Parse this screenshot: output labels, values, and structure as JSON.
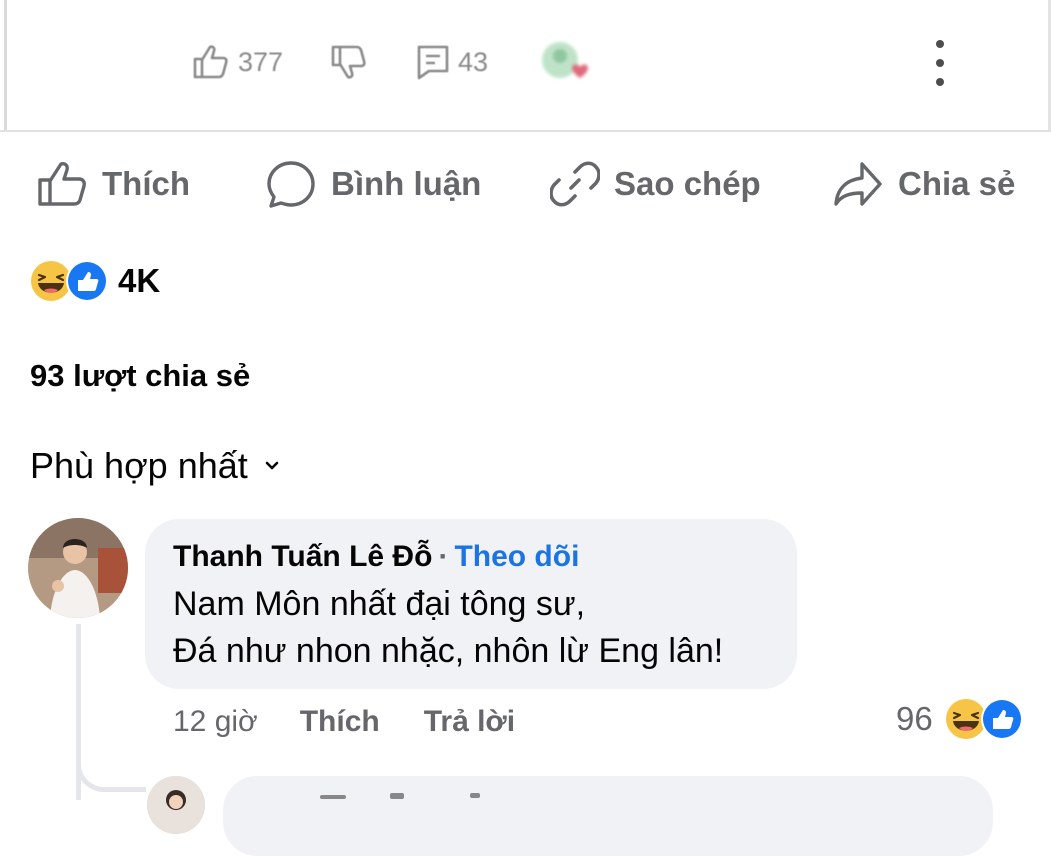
{
  "embedded_post": {
    "like_count": "377",
    "comment_count": "43"
  },
  "actions": {
    "like": "Thích",
    "comment": "Bình luận",
    "copy": "Sao chép",
    "share": "Chia sẻ"
  },
  "reactions": {
    "count": "4K",
    "types": [
      "haha-emoji-icon",
      "like-reaction-icon"
    ]
  },
  "shares": "93 lượt chia sẻ",
  "sort": {
    "label": "Phù hợp nhất"
  },
  "comment": {
    "author": "Thanh Tuấn Lê Đỗ",
    "separator": "·",
    "follow": "Theo dõi",
    "line1": "Nam Môn nhất đại tông sư,",
    "line2": "Đá như nhon nhặc, nhôn lừ Eng lân!",
    "time": "12 giờ",
    "like": "Thích",
    "reply": "Trả lời",
    "reaction_count": "96"
  },
  "colors": {
    "text": "#050505",
    "secondary": "#65676b",
    "link": "#1b74e4",
    "bubble": "#f0f2f5",
    "like_blue": "#1877f2",
    "haha_yellow": "#f7c545"
  }
}
